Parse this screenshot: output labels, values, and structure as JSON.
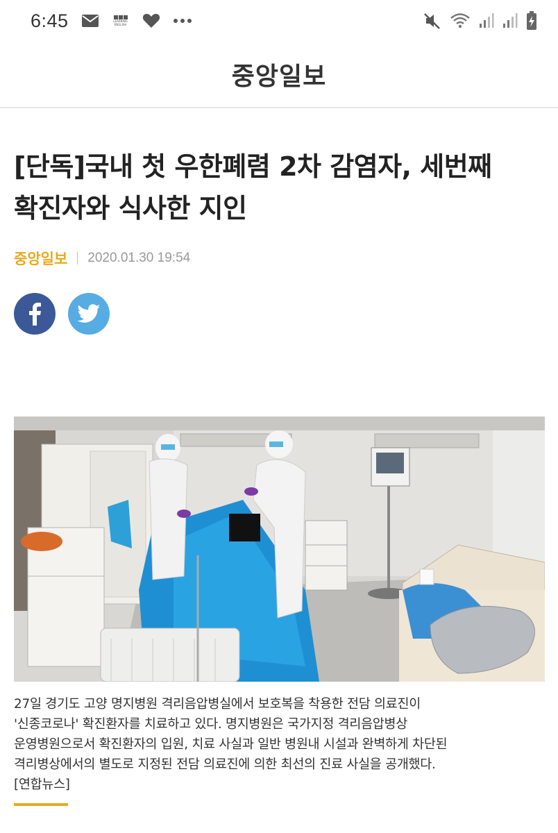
{
  "status_bar": {
    "time": "6:45",
    "left_icons": [
      "mail-icon",
      "bbc-learning-english-icon",
      "heart-icon",
      "more-dots-icon"
    ],
    "right_icons": [
      "mute-icon",
      "wifi-icon",
      "signal-icon",
      "signal-icon",
      "battery-charging-icon"
    ]
  },
  "header": {
    "logo": "중앙일보"
  },
  "article": {
    "headline_lines": [
      "[단독]국내 첫 우한폐렴 2차 감염자, 세번째",
      "확진자와 식사한 지인"
    ],
    "source": "중앙일보",
    "date": "2020.01.30 19:54",
    "share": {
      "facebook_icon": "facebook-icon",
      "twitter_icon": "twitter-icon"
    },
    "caption_lines": [
      "27일 경기도 고양 명지병원 격리음압병실에서 보호복을 착용한 전담 의료진이",
      "'신종코로나' 확진환자를 치료하고 있다. 명지병원은 국가지정 격리음압병상",
      "운영병원으로서 확진환자의 입원, 치료 사실과 일반 병원내 시설과 완벽하게 차단된",
      "격리병상에서의 별도로 지정된 전담 의료진에 의한 최선의 진료 사실을 공개했다.",
      "[연합뉴스]"
    ]
  },
  "colors": {
    "accent": "#e8a91c",
    "facebook": "#3b5998",
    "twitter": "#56ace3",
    "headline": "#222222",
    "date": "#999999"
  }
}
